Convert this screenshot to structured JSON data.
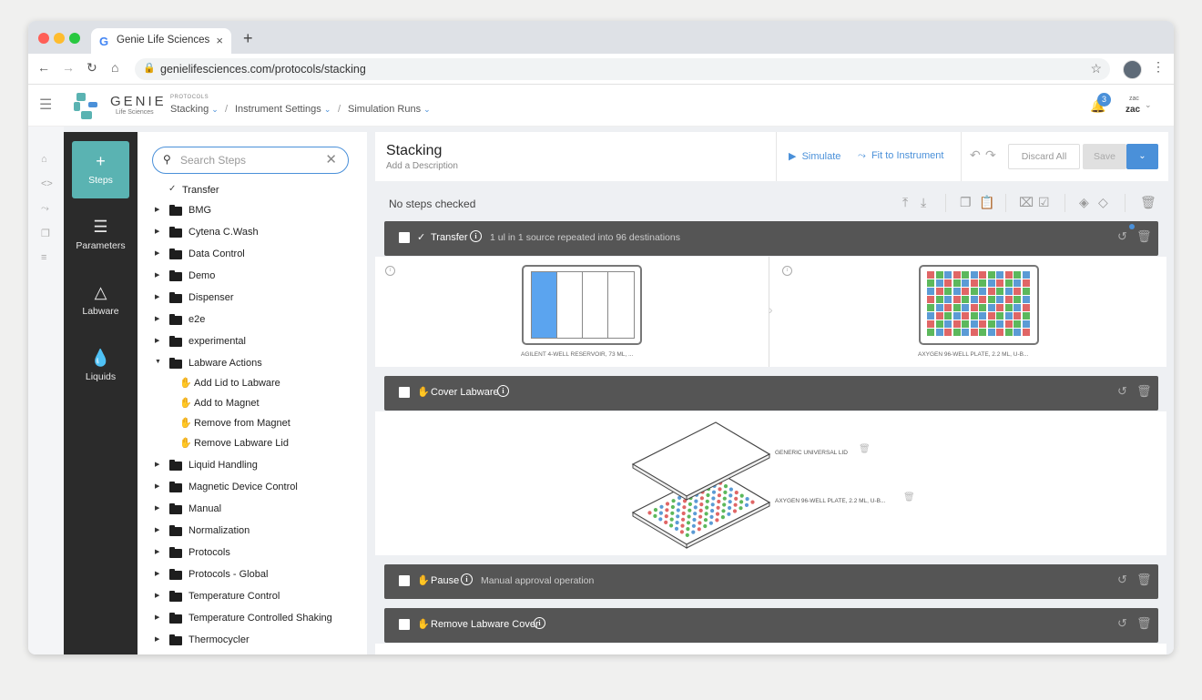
{
  "browser": {
    "tab_title": "Genie Life Sciences",
    "tab_close": "×",
    "new_tab": "+",
    "url": "genielifesciences.com/protocols/stacking"
  },
  "header": {
    "brand": "GENIE",
    "brand_sub": "Life Sciences",
    "breadcrumb_caption": "PROTOCOLS",
    "breadcrumbs": [
      {
        "label": "Stacking"
      },
      {
        "label": "Instrument Settings"
      },
      {
        "label": "Simulation Runs"
      }
    ],
    "notification_count": "3",
    "user_small": "zac",
    "user": "zac"
  },
  "nav": [
    {
      "label": "Steps",
      "icon": "plus-icon",
      "active": true
    },
    {
      "label": "Parameters",
      "icon": "checklist-icon"
    },
    {
      "label": "Labware",
      "icon": "flask-icon"
    },
    {
      "label": "Liquids",
      "icon": "drop-icon"
    }
  ],
  "tree": {
    "search_placeholder": "Search Steps",
    "transfer_label": "Transfer",
    "folders_top": [
      {
        "label": "BMG"
      },
      {
        "label": "Cytena C.Wash"
      },
      {
        "label": "Data Control"
      },
      {
        "label": "Demo"
      },
      {
        "label": "Dispenser"
      },
      {
        "label": "e2e"
      },
      {
        "label": "experimental"
      },
      {
        "label": "Labware Actions"
      }
    ],
    "labware_actions": [
      {
        "label": "Add Lid to Labware"
      },
      {
        "label": "Add to Magnet"
      },
      {
        "label": "Remove from Magnet"
      },
      {
        "label": "Remove Labware Lid"
      }
    ],
    "folders_bottom": [
      {
        "label": "Liquid Handling"
      },
      {
        "label": "Magnetic Device Control"
      },
      {
        "label": "Manual"
      },
      {
        "label": "Normalization"
      },
      {
        "label": "Protocols"
      },
      {
        "label": "Protocols - Global"
      },
      {
        "label": "Temperature Control"
      },
      {
        "label": "Temperature Controlled Shaking"
      },
      {
        "label": "Thermocycler"
      }
    ]
  },
  "protocol": {
    "title": "Stacking",
    "description": "Add a Description",
    "simulate": "Simulate",
    "fit": "Fit to Instrument",
    "discard": "Discard All",
    "save": "Save",
    "checked_status": "No steps checked"
  },
  "steps": [
    {
      "name": "Transfer",
      "description": "1 ul in 1 source repeated into 96 destinations"
    },
    {
      "name": "Cover Labware",
      "description": ""
    },
    {
      "name": "Pause",
      "description": "Manual approval operation"
    },
    {
      "name": "Remove Labware Cover",
      "description": ""
    }
  ],
  "transfer": {
    "source_label": "AGILENT 4-WELL RESERVOIR, 73 ML, ...",
    "dest_label": "AXYGEN 96-WELL PLATE, 2.2 ML, U-B..."
  },
  "cover": {
    "lid_label": "GENERIC UNIVERSAL LID",
    "plate_label": "AXYGEN 96-WELL PLATE, 2.2 ML, U-B..."
  },
  "colors": {
    "accent": "#4a90d9",
    "brand": "#5ab3b2",
    "well_red": "#e06666",
    "well_green": "#5cb85c",
    "well_blue": "#5b9bd5"
  }
}
